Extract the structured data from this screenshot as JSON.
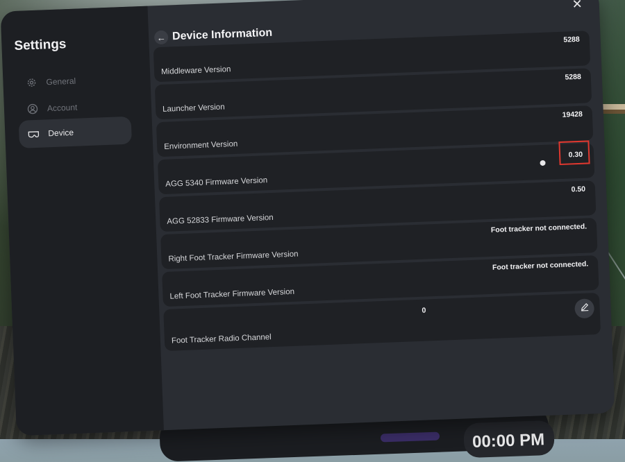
{
  "sidebar": {
    "title": "Settings",
    "items": [
      {
        "label": "General",
        "icon": "gear-icon",
        "active": false
      },
      {
        "label": "Account",
        "icon": "account-icon",
        "active": false
      },
      {
        "label": "Device",
        "icon": "headset-icon",
        "active": true
      }
    ]
  },
  "header": {
    "title": "Device Information",
    "back_icon": "arrow-left-icon",
    "close_icon": "close-icon"
  },
  "rows": [
    {
      "label": "Middleware Version",
      "value": "5288"
    },
    {
      "label": "Launcher Version",
      "value": "5288"
    },
    {
      "label": "Environment Version",
      "value": "19428"
    },
    {
      "label": "AGG 5340 Firmware Version",
      "value": "0.30"
    },
    {
      "label": "AGG 52833 Firmware Version",
      "value": "0.50"
    },
    {
      "label": "Right Foot Tracker Firmware Version",
      "value": "Foot tracker not connected."
    },
    {
      "label": "Left Foot Tracker Firmware Version",
      "value": "Foot tracker not connected."
    },
    {
      "label": "Foot Tracker Radio Channel",
      "value": "0",
      "edit_icon": "pencil-icon"
    }
  ],
  "clock": {
    "time": "00:00 PM"
  },
  "colors": {
    "highlight": "#e0382f",
    "panel": "#2a2d33",
    "sidebar": "#1d1f23",
    "row": "#1f2125"
  }
}
